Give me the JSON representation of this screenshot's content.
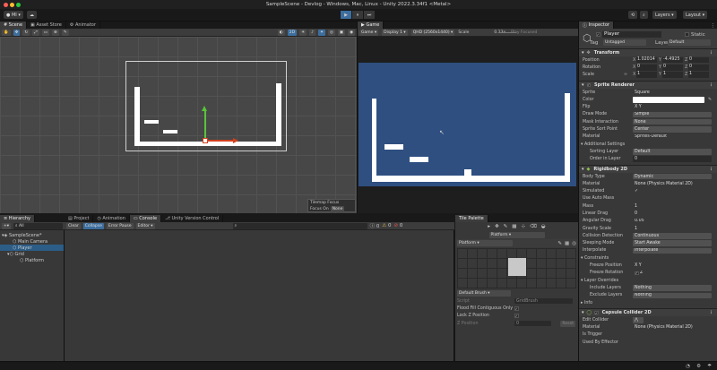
{
  "window": {
    "title": "SampleScene - Devlog - Windows, Mac, Linux - Unity 2022.3.34f1 <Metal>"
  },
  "toolbar": {
    "account": "MI",
    "play": "▶",
    "pause": "⏸",
    "step": "⏭",
    "layers": "Layers",
    "layout": "Layout"
  },
  "scene_tabs": [
    "Scene",
    "Asset Store",
    "Animator"
  ],
  "game": {
    "tab": "Game",
    "mode": "Game",
    "display": "Display 1",
    "resolution": "QHD (2560x1440)",
    "scale_label": "Scale",
    "scale_value": "0.23x",
    "play_focused": "Play Focused",
    "overlay_title": "Tilemap Focus",
    "focus_on_label": "Focus On",
    "focus_on_value": "None"
  },
  "hierarchy": {
    "tab": "Hierarchy",
    "search_placeholder": "All",
    "items": [
      {
        "label": "SampleScene*",
        "indent": 0
      },
      {
        "label": "Main Camera",
        "indent": 1
      },
      {
        "label": "Player",
        "indent": 1
      },
      {
        "label": "Grid",
        "indent": 1
      },
      {
        "label": "Platform",
        "indent": 2
      }
    ]
  },
  "console": {
    "tabs": [
      "Project",
      "Animation",
      "Console",
      "Unity Version Control"
    ],
    "buttons": [
      "Clear",
      "Collapse",
      "Error Pause",
      "Editor"
    ],
    "counts": [
      "0",
      "0",
      "0"
    ]
  },
  "tile_palette": {
    "tab": "Tile Palette",
    "active_palette": "Platform",
    "target": "Platform",
    "default_brush": "Default Brush",
    "script_label": "Script",
    "script_value": "GridBrush",
    "flood_fill_label": "Flood Fill Contiguous Only",
    "lock_z_label": "Lock Z Position",
    "z_position_label": "Z Position",
    "z_position_value": "0",
    "reset_label": "Reset"
  },
  "inspector": {
    "tab": "Inspector",
    "object_name": "Player",
    "static_label": "Static",
    "tag_label": "Tag",
    "tag_value": "Untagged",
    "layer_label": "Layer",
    "layer_value": "Default",
    "transform": {
      "title": "Transform",
      "position_label": "Position",
      "position": {
        "x": "1.02014",
        "y": "-4.4925",
        "z": "0"
      },
      "rotation_label": "Rotation",
      "rotation": {
        "x": "0",
        "y": "0",
        "z": "0"
      },
      "scale_label": "Scale",
      "scale": {
        "x": "1",
        "y": "1",
        "z": "1"
      }
    },
    "sprite_renderer": {
      "title": "Sprite Renderer",
      "rows": [
        {
          "label": "Sprite",
          "value": "Square"
        },
        {
          "label": "Color",
          "value": ""
        },
        {
          "label": "Flip",
          "value": "X   Y"
        },
        {
          "label": "Draw Mode",
          "value": "Simple"
        },
        {
          "label": "Mask Interaction",
          "value": "None"
        },
        {
          "label": "Sprite Sort Point",
          "value": "Center"
        },
        {
          "label": "Material",
          "value": "Sprites-Default"
        }
      ],
      "additional_title": "Additional Settings",
      "sorting_layer_label": "Sorting Layer",
      "sorting_layer_value": "Default",
      "order_label": "Order in Layer",
      "order_value": "0"
    },
    "rigidbody": {
      "title": "Rigidbody 2D",
      "rows": [
        {
          "label": "Body Type",
          "value": "Dynamic"
        },
        {
          "label": "Material",
          "value": "None (Physics Material 2D)"
        },
        {
          "label": "Simulated",
          "value": "✓"
        },
        {
          "label": "Use Auto Mass",
          "value": ""
        },
        {
          "label": "Mass",
          "value": "1"
        },
        {
          "label": "Linear Drag",
          "value": "0"
        },
        {
          "label": "Angular Drag",
          "value": "0.05"
        },
        {
          "label": "Gravity Scale",
          "value": "1"
        },
        {
          "label": "Collision Detection",
          "value": "Continuous"
        },
        {
          "label": "Sleeping Mode",
          "value": "Start Awake"
        },
        {
          "label": "Interpolate",
          "value": "Interpolate"
        }
      ],
      "constraints_title": "Constraints",
      "freeze_position_label": "Freeze Position",
      "freeze_position_value": "X   Y",
      "freeze_rotation_label": "Freeze Rotation",
      "freeze_rotation_value": "Z",
      "layer_overrides_title": "Layer Overrides",
      "include_label": "Include Layers",
      "include_value": "Nothing",
      "exclude_label": "Exclude Layers",
      "exclude_value": "Nothing",
      "info_title": "Info"
    },
    "capsule": {
      "title": "Capsule Collider 2D",
      "rows": [
        {
          "label": "Edit Collider",
          "value": ""
        },
        {
          "label": "Material",
          "value": "None (Physics Material 2D)"
        },
        {
          "label": "Is Trigger",
          "value": ""
        },
        {
          "label": "Used By Effector",
          "value": ""
        }
      ]
    }
  }
}
